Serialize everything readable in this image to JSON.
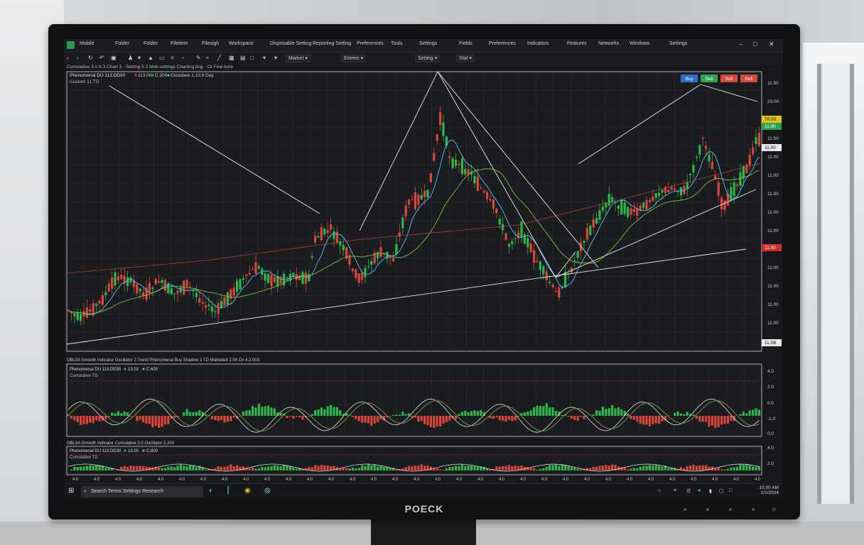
{
  "app": {
    "menu": [
      "Mobile",
      "Folder",
      "Folder",
      "Fileitem",
      "Filesigh",
      "Workspace",
      "Disposable Setting",
      "Reporting Setting",
      "Preferences",
      "Tools",
      "Settings",
      "Fields",
      "Preferences",
      "Indicators",
      "Features",
      "Networks",
      "Windows",
      "Settings"
    ],
    "controls": [
      "–",
      "□",
      "✕"
    ]
  },
  "toolbar": {
    "dropdowns": [
      "Market",
      "Entries",
      "Setting",
      "Stat"
    ],
    "info_line": "Cumulative 5 h 6.3 Chart 3 · Setting 5.3 Mob settings Charting.ting · Cli Fine-tune"
  },
  "main_chart": {
    "header": "Phenomenal DU 113.DD30",
    "header_values": [
      "113.00",
      "C.300",
      "Cloudsee 1.10.8 Day"
    ],
    "subheader": "Custom 11 TD",
    "buttons": [
      {
        "label": "Buy",
        "color": "#2f6fd0"
      },
      {
        "label": "Sell",
        "color": "#2fa24c"
      },
      {
        "label": "Sell",
        "color": "#d34b3d"
      },
      {
        "label": "Sell",
        "color": "#d34b3d"
      }
    ],
    "price_axis": [
      "11.50",
      "23.00",
      "",
      "11.50",
      "11.00",
      "11.00",
      "11.00",
      "11.00",
      "11.00",
      "11.00",
      "11.00",
      "11.00",
      "11.00",
      "11.00",
      "11.00"
    ],
    "price_tags": [
      {
        "label": "70.00",
        "color": "#e0c21d"
      },
      {
        "label": "11.00",
        "color": "#2fa24c"
      },
      {
        "label": "11.00",
        "color": "#e8e8e8"
      },
      {
        "label": "11.00",
        "color": "#d32c2c"
      },
      {
        "label": "11.0B",
        "color": "#e8e8e8"
      }
    ]
  },
  "oscillator_1": {
    "title": "OBLIIA Smooth Indicator Oscillator 2 Trend Phenomenal Buy Shadow 1 TD Marketed 2.04 Ox 4.2.003",
    "legend": "Phenomenal DU 113.DD30",
    "legend_values": [
      "13.03",
      "C.600"
    ],
    "sub": "Cumulative TD",
    "axis": [
      "4.0",
      "2.0",
      "0.0",
      "-1.0",
      "0.0"
    ]
  },
  "oscillator_2": {
    "title": "OBLIIA Smooth Indicator Cumulative 2.0 Oscillator 3.203",
    "legend": "Phenomenal DU 113.DD30",
    "legend_values": [
      "13.00",
      "C.600"
    ],
    "sub": "Cumulative TD",
    "axis": [
      "4.0",
      "2.0"
    ]
  },
  "time_axis": [
    "4.0",
    "4.0",
    "4.0",
    "4.0",
    "4.0",
    "4.0",
    "4.0",
    "4.0",
    "4.0",
    "4.0",
    "4.0",
    "4.0",
    "4.0",
    "4.0",
    "4.0",
    "4.0",
    "4.0",
    "4.0",
    "4.0",
    "4.0",
    "4.0",
    "4.0",
    "4.0",
    "4.0",
    "4.0",
    "4.0",
    "4.0",
    "4.0",
    "4.0",
    "4.0",
    "4.0",
    "4.0",
    "4.0"
  ],
  "taskbar": {
    "search_text": "Search Terms Settings Research",
    "tray_time": "10:00 AM",
    "tray_date": "1/1/2024"
  },
  "monitor": {
    "brand": "POECK"
  },
  "colors": {
    "bg": "#17181b",
    "grid": "#2c2f36",
    "up": "#2fb84a",
    "down": "#d9473a",
    "ma_blue": "#4fb3e8",
    "ma_green": "#7cc043",
    "ma_red": "#d14a3c",
    "trend": "#e8e8e8"
  }
}
